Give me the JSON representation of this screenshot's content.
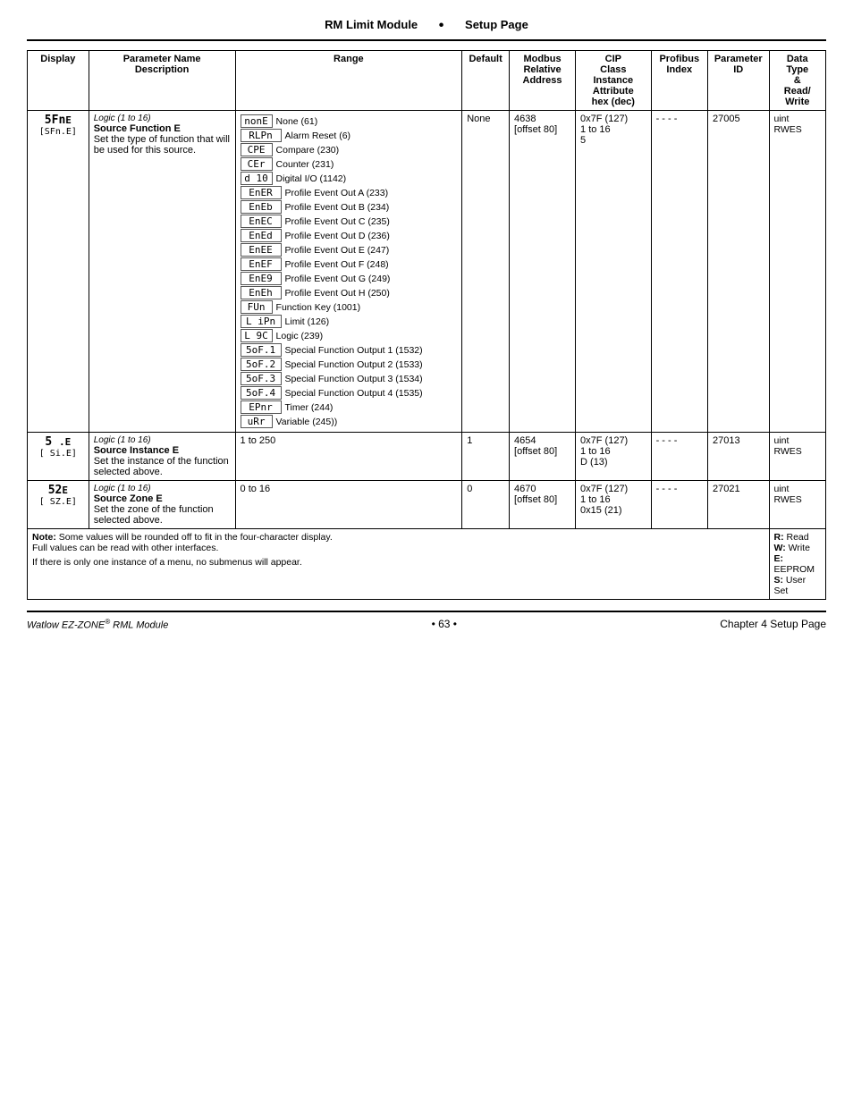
{
  "header": {
    "title": "RM Limit Module",
    "bullet": "•",
    "subtitle": "Setup Page"
  },
  "table": {
    "columns": [
      {
        "label": "Display",
        "key": "display"
      },
      {
        "label": "Parameter Name Description",
        "key": "param"
      },
      {
        "label": "Range",
        "key": "range"
      },
      {
        "label": "Default",
        "key": "default"
      },
      {
        "label": "Modbus Relative Address",
        "key": "modbus"
      },
      {
        "label": "CIP Class Instance Attribute hex (dec)",
        "key": "cip"
      },
      {
        "label": "Profibus Index",
        "key": "profibus"
      },
      {
        "label": "Parameter ID",
        "key": "paramid"
      },
      {
        "label": "Data Type & Read/Write",
        "key": "datatype"
      }
    ],
    "rows": [
      {
        "display": "5FnE\n[SFn.E]",
        "param_logic": "Logic (1 to 16)",
        "param_name": "Source Function E",
        "param_desc": "Set the type of function that will be used for this source.",
        "range_items": [
          {
            "box": "nonE",
            "label": "None (61)"
          },
          {
            "box": "RLPn",
            "label": "Alarm Reset (6)"
          },
          {
            "box": "CPE",
            "label": "Compare (230)"
          },
          {
            "box": "CEr",
            "label": "Counter (231)"
          },
          {
            "box": "d 10",
            "label": "Digital I/O (1142)"
          },
          {
            "box": "EnER",
            "label": "Profile Event Out A (233)"
          },
          {
            "box": "EnEb",
            "label": "Profile Event Out B (234)"
          },
          {
            "box": "EnEC",
            "label": "Profile Event Out C (235)"
          },
          {
            "box": "EnEd",
            "label": "Profile Event Out D (236)"
          },
          {
            "box": "EnEE",
            "label": "Profile Event Out E (247)"
          },
          {
            "box": "EnEF",
            "label": "Profile Event Out F (248)"
          },
          {
            "box": "EnE9",
            "label": "Profile Event Out G (249)"
          },
          {
            "box": "EnEh",
            "label": "Profile Event Out H (250)"
          },
          {
            "box": "FUn",
            "label": "Function Key (1001)"
          },
          {
            "box": "L iPn",
            "label": "Limit (126)"
          },
          {
            "box": "L 9C",
            "label": "Logic (239)"
          },
          {
            "box": "5oF.1",
            "label": "Special Function Output 1 (1532)"
          },
          {
            "box": "5oF.2",
            "label": "Special Function Output 2 (1533)"
          },
          {
            "box": "5oF.3",
            "label": "Special Function Output 3 (1534)"
          },
          {
            "box": "5oF.4",
            "label": "Special Function Output 4 (1535)"
          },
          {
            "box": "EPnr",
            "label": "Timer (244)"
          },
          {
            "box": "uRr",
            "label": "Variable (245))"
          }
        ],
        "default": "None",
        "modbus": "4638\n[offset 80]",
        "cip": "0x7F (127)\n1 to 16\n5",
        "profibus": "- - - -",
        "paramid": "27005",
        "datatype": "uint\nRWES"
      },
      {
        "display": "5 .E\n[ Si.E]",
        "param_logic": "Logic (1 to 16)",
        "param_name": "Source Instance E",
        "param_desc": "Set the instance of the function selected above.",
        "range_simple": "1 to 250",
        "default": "1",
        "modbus": "4654\n[offset 80]",
        "cip": "0x7F (127)\n1 to 16\nD (13)",
        "profibus": "- - - -",
        "paramid": "27013",
        "datatype": "uint\nRWES"
      },
      {
        "display": "52E\n[ SZ.E]",
        "param_logic": "Logic (1 to 16)",
        "param_name": "Source Zone E",
        "param_desc": "Set the zone of the function selected above.",
        "range_simple": "0 to 16",
        "default": "0",
        "modbus": "4670\n[offset 80]",
        "cip": "0x7F (127)\n1 to 16\n0x15 (21)",
        "profibus": "- - - -",
        "paramid": "27021",
        "datatype": "uint\nRWES"
      }
    ],
    "note": {
      "line1": "Note: Some values will be rounded off to fit in the four-character display.",
      "line2": "Full values can be read with other interfaces.",
      "line3": "If there is only one instance of a menu, no submenus will appear."
    },
    "legend": "R: Read\nW: Write\nE: EEPROM\nS: User Set"
  },
  "footer": {
    "left": "Watlow EZ-ZONE",
    "trademark": "®",
    "left2": " RML Module",
    "center": "• 63 •",
    "right": "Chapter 4 Setup Page"
  }
}
